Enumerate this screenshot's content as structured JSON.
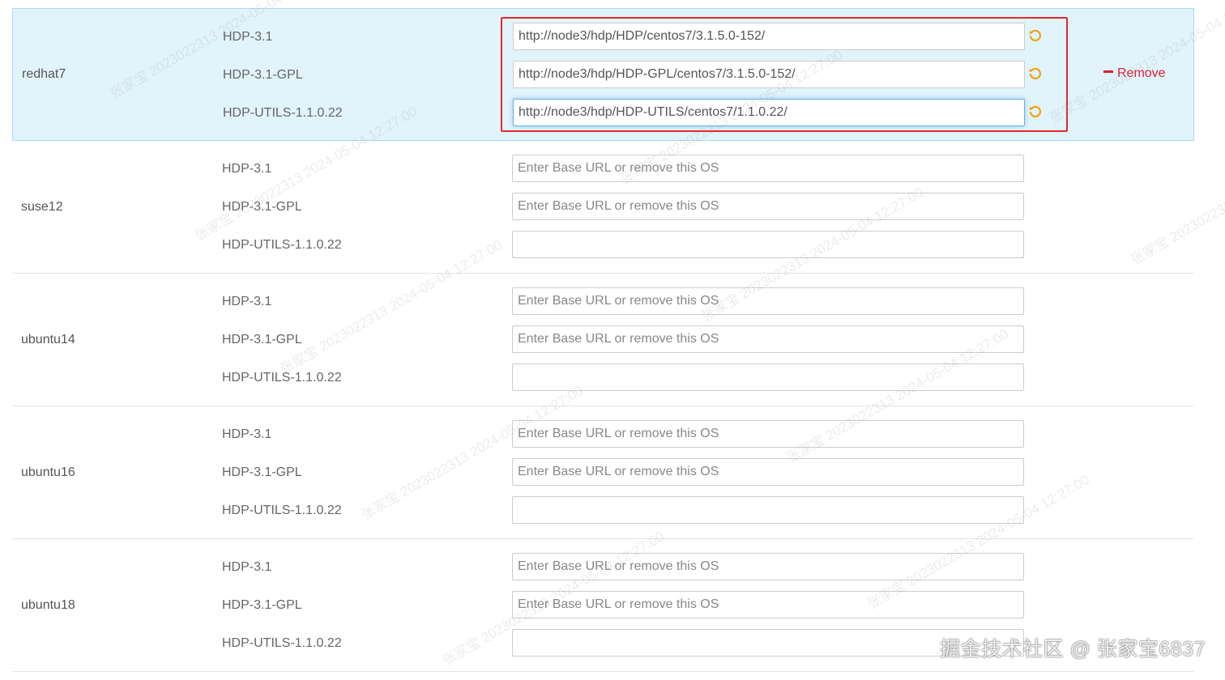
{
  "os_rows": [
    {
      "name": "redhat7",
      "selected": true,
      "remove_label": "Remove",
      "repos": [
        {
          "name": "HDP-3.1",
          "value": "http://node3/hdp/HDP/centos7/3.1.5.0-152/",
          "placeholder": ""
        },
        {
          "name": "HDP-3.1-GPL",
          "value": "http://node3/hdp/HDP-GPL/centos7/3.1.5.0-152/",
          "placeholder": ""
        },
        {
          "name": "HDP-UTILS-1.1.0.22",
          "value": "http://node3/hdp/HDP-UTILS/centos7/1.1.0.22/",
          "placeholder": ""
        }
      ]
    },
    {
      "name": "suse12",
      "repos": [
        {
          "name": "HDP-3.1",
          "value": "",
          "placeholder": "Enter Base URL or remove this OS"
        },
        {
          "name": "HDP-3.1-GPL",
          "value": "",
          "placeholder": "Enter Base URL or remove this OS"
        },
        {
          "name": "HDP-UTILS-1.1.0.22",
          "value": "",
          "placeholder": ""
        }
      ]
    },
    {
      "name": "ubuntu14",
      "repos": [
        {
          "name": "HDP-3.1",
          "value": "",
          "placeholder": "Enter Base URL or remove this OS"
        },
        {
          "name": "HDP-3.1-GPL",
          "value": "",
          "placeholder": "Enter Base URL or remove this OS"
        },
        {
          "name": "HDP-UTILS-1.1.0.22",
          "value": "",
          "placeholder": ""
        }
      ]
    },
    {
      "name": "ubuntu16",
      "repos": [
        {
          "name": "HDP-3.1",
          "value": "",
          "placeholder": "Enter Base URL or remove this OS"
        },
        {
          "name": "HDP-3.1-GPL",
          "value": "",
          "placeholder": "Enter Base URL or remove this OS"
        },
        {
          "name": "HDP-UTILS-1.1.0.22",
          "value": "",
          "placeholder": ""
        }
      ]
    },
    {
      "name": "ubuntu18",
      "repos": [
        {
          "name": "HDP-3.1",
          "value": "",
          "placeholder": "Enter Base URL or remove this OS"
        },
        {
          "name": "HDP-3.1-GPL",
          "value": "",
          "placeholder": "Enter Base URL or remove this OS"
        },
        {
          "name": "HDP-UTILS-1.1.0.22",
          "value": "",
          "placeholder": ""
        }
      ]
    }
  ],
  "colors": {
    "selected_bg": "#e1f3fb",
    "highlight_box": "#e32a2a",
    "remove_text": "#e0202f",
    "undo_icon": "#f0a30a"
  },
  "icons": {
    "undo": "undo-icon",
    "remove": "minus-icon"
  },
  "watermark_text": "张家宝 2023022313 2024-05-04 12:27:00",
  "brand_text": "掘金技术社区 @ 张家宝6837"
}
